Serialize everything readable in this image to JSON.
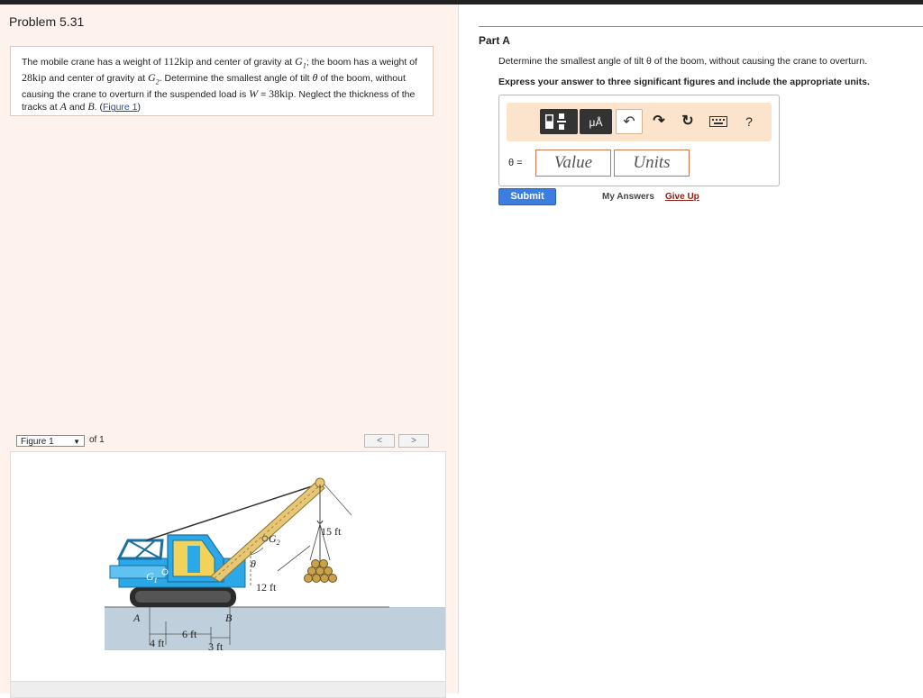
{
  "problem": {
    "title": "Problem 5.31",
    "text": {
      "t1": "The mobile crane has a weight of ",
      "w1": "112kip",
      "t2": " and center of gravity at ",
      "g1": "G",
      "g1sub": "1",
      "t3": "; the boom has a weight of ",
      "w2": "28kip",
      "t4": " and center of gravity at ",
      "g2": "G",
      "g2sub": "2",
      "t5": ". Determine the smallest angle of tilt ",
      "theta": "θ",
      "t6": " of the boom, without causing the crane to overturn if the suspended load is ",
      "wvar": "W",
      "t7": " = ",
      "w3": "38kip",
      "t8": ". Neglect the thickness of the tracks at ",
      "a": "A",
      "t9": " and ",
      "b": "B",
      "t10": ". (",
      "fig_link": "Figure 1",
      "t11": ")"
    }
  },
  "figure_nav": {
    "select_label": "Figure 1",
    "of_label": "of 1",
    "prev": "<",
    "next": ">"
  },
  "figure_labels": {
    "A": "A",
    "B": "B",
    "G1": "G",
    "G1sub": "1",
    "G2": "G",
    "G2sub": "2",
    "theta": "θ",
    "d15": "15 ft",
    "d12": "12 ft",
    "d6": "6 ft",
    "d4": "4 ft",
    "d3": "3 ft"
  },
  "part": {
    "title": "Part A",
    "question": "Determine the smallest angle of tilt θ of the boom, without causing the crane to overturn.",
    "instructions": "Express your answer to three significant figures and include the appropriate units.",
    "toolbar": {
      "templates": "templates",
      "units_btn": "μÅ",
      "undo": "↶",
      "redo": "↷",
      "reset": "↻",
      "keyboard": "keyboard",
      "help": "?"
    },
    "answer_label": "θ =",
    "value_placeholder": "Value",
    "units_placeholder": "Units",
    "submit": "Submit",
    "my_answers": "My Answers",
    "give_up": "Give Up"
  },
  "colors": {
    "accent": "#3e7de0",
    "crane_blue": "#2aa8e8",
    "panel_bg": "#fdf3ec",
    "toolbar_bg": "#fbe3cc"
  }
}
